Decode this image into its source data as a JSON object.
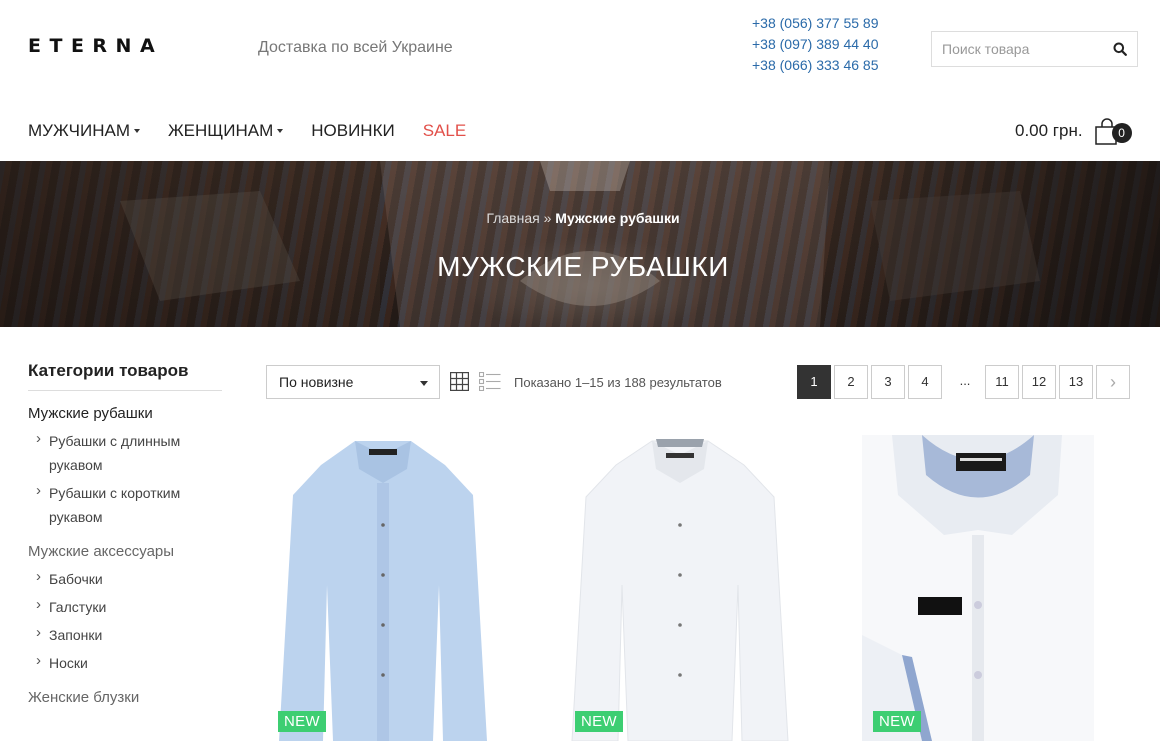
{
  "header": {
    "logo": "ETERNA",
    "tagline": "Доставка по всей Украине",
    "phones": [
      "+38 (056) 377 55 89",
      "+38 (097) 389 44 40",
      "+38 (066) 333 46 85"
    ],
    "search_placeholder": "Поиск товара"
  },
  "nav": {
    "items": [
      {
        "label": "МУЖЧИНАМ",
        "dropdown": true
      },
      {
        "label": "ЖЕНЩИНАМ",
        "dropdown": true
      },
      {
        "label": "НОВИНКИ",
        "dropdown": false
      },
      {
        "label": "SALE",
        "dropdown": false
      }
    ],
    "cart_total": "0.00 грн.",
    "cart_count": "0"
  },
  "hero": {
    "breadcrumb_home": "Главная",
    "breadcrumb_sep": " » ",
    "breadcrumb_current": "Мужские рубашки",
    "title": "МУЖСКИЕ РУБАШКИ"
  },
  "sidebar": {
    "title": "Категории товаров",
    "cat1": "Мужские рубашки",
    "cat1_subs": [
      "Рубашки с длинным рукавом",
      "Рубашки с коротким рукавом"
    ],
    "cat2": "Мужские аксессуары",
    "cat2_subs": [
      "Бабочки",
      "Галстуки",
      "Запонки",
      "Носки"
    ],
    "cat3": "Женские блузки"
  },
  "toolbar": {
    "sort_value": "По новизне",
    "results": "Показано 1–15 из 188 результатов"
  },
  "pagination": {
    "pages": [
      "1",
      "2",
      "3",
      "4",
      "...",
      "11",
      "12",
      "13"
    ],
    "active": "1",
    "next": "›"
  },
  "products": [
    {
      "badge": "NEW",
      "color": "light blue"
    },
    {
      "badge": "NEW",
      "color": "white"
    },
    {
      "badge": "NEW",
      "color": "white"
    }
  ],
  "colors": {
    "phone": "#2a6aa9",
    "sale": "#e2504a",
    "badge": "#3dce72"
  }
}
